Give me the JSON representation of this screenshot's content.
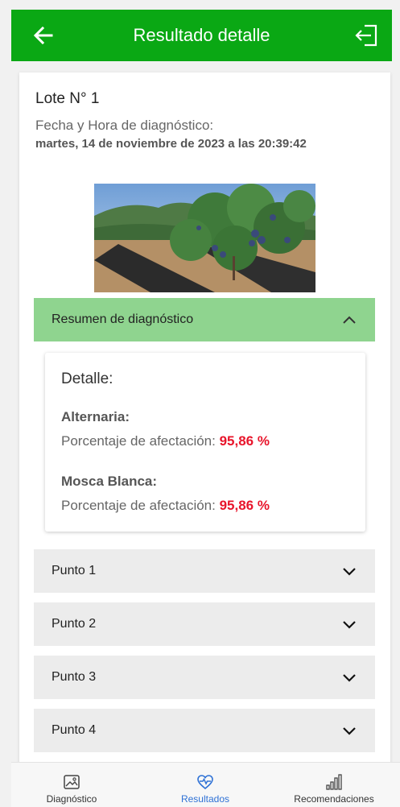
{
  "header": {
    "title": "Resultado detalle",
    "back_icon": "arrow-left-icon",
    "logout_icon": "logout-icon",
    "bg_color": "#0aa814"
  },
  "lote": {
    "title": "Lote N° 1",
    "fecha_label": "Fecha y Hora de diagnóstico:",
    "fecha_value": "martes, 14 de noviembre de 2023 a las 20:39:42"
  },
  "summary": {
    "label": "Resumen de diagnóstico",
    "expanded": true,
    "bg_color": "#8fd48f"
  },
  "detail": {
    "title": "Detalle:",
    "items": [
      {
        "name": "Alternaria:",
        "pct_label": "Porcentaje de afectación:",
        "pct_value": "95,86 %"
      },
      {
        "name": "Mosca Blanca:",
        "pct_label": "Porcentaje de afectación:",
        "pct_value": "95,86 %"
      }
    ],
    "pct_color": "#e8152b"
  },
  "puntos": [
    {
      "label": "Punto 1"
    },
    {
      "label": "Punto 2"
    },
    {
      "label": "Punto 3"
    },
    {
      "label": "Punto 4"
    }
  ],
  "bottom_nav": {
    "items": [
      {
        "label": "Diagnóstico",
        "icon": "image-icon",
        "active": false
      },
      {
        "label": "Resultados",
        "icon": "heart-pulse-icon",
        "active": true
      },
      {
        "label": "Recomendaciones",
        "icon": "bar-chart-icon",
        "active": false
      }
    ],
    "active_color": "#2f72d6"
  }
}
